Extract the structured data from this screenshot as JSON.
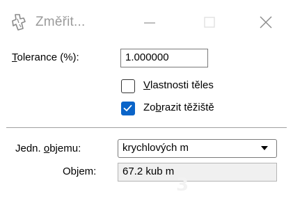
{
  "window": {
    "title": "Změřit...",
    "app_icon": "measure-tool-icon",
    "controls": [
      "minimize-icon",
      "maximize-icon",
      "close-icon"
    ]
  },
  "tolerance": {
    "label_access": "T",
    "label_rest": "olerance (%):",
    "value": "1.000000"
  },
  "options": {
    "solid_properties": {
      "checked": false,
      "label_access": "V",
      "label_rest": "lastnosti těles"
    },
    "show_centroid": {
      "checked": true,
      "label_pre": "Zo",
      "label_access": "b",
      "label_rest": "razit těžiště"
    }
  },
  "volume_units": {
    "label_pre": "Jedn. ",
    "label_access": "o",
    "label_rest": "bjemu:",
    "selected": "krychlových m"
  },
  "volume": {
    "label": "Objem:",
    "value": "67.2 kub  m",
    "overlay_digit": "3"
  },
  "colors": {
    "accent": "#0a64c8",
    "title_text": "#9a9a9a",
    "divider": "#a0a0a0"
  }
}
